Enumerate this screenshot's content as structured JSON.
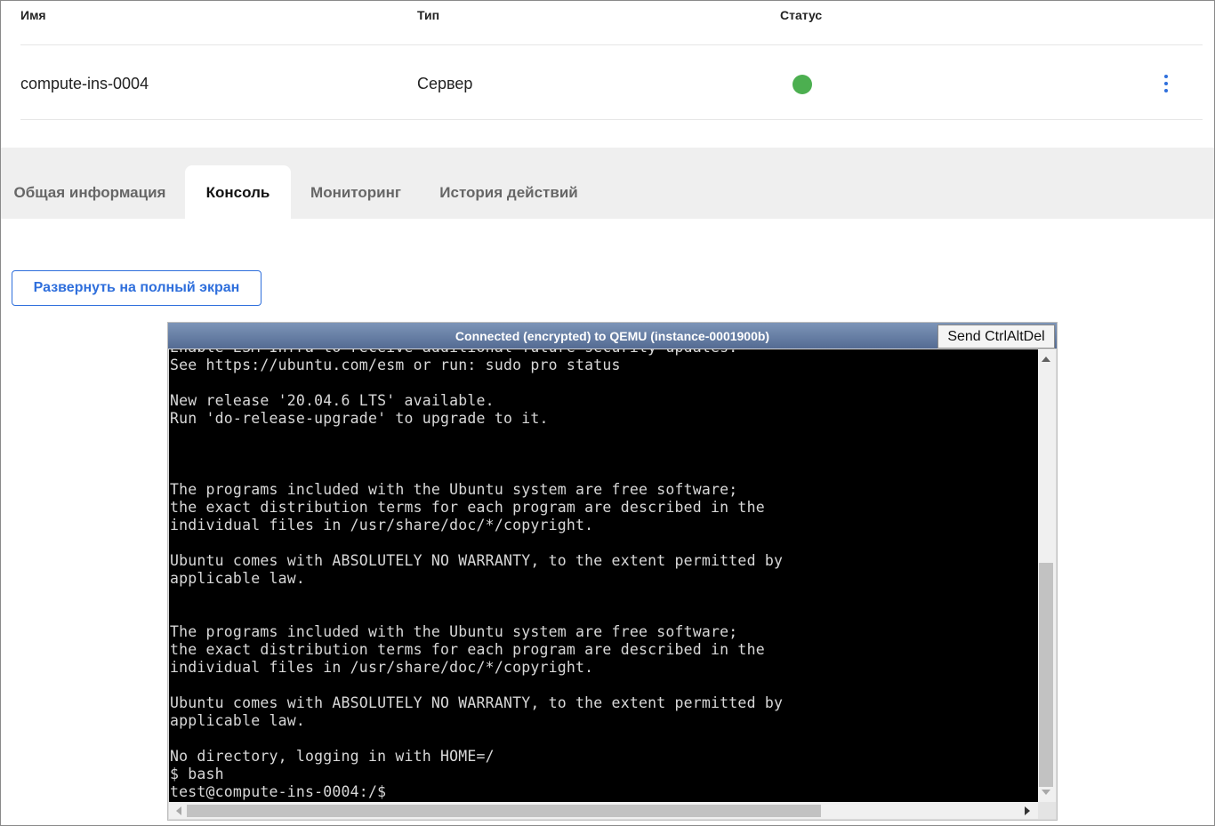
{
  "table": {
    "headers": {
      "name": "Имя",
      "type": "Тип",
      "status": "Статус"
    },
    "row": {
      "name": "compute-ins-0004",
      "type": "Сервер",
      "status_color": "#4caf50"
    }
  },
  "tabs": [
    {
      "label": "Общая информация",
      "active": false
    },
    {
      "label": "Консоль",
      "active": true
    },
    {
      "label": "Мониторинг",
      "active": false
    },
    {
      "label": "История действий",
      "active": false
    }
  ],
  "fullscreen_button": "Развернуть на полный экран",
  "console": {
    "title": "Connected (encrypted) to QEMU (instance-0001900b)",
    "ctrl_alt_del": "Send CtrlAltDel",
    "lines": [
      "Enable ESM Infra to receive additional future security updates.",
      "See https://ubuntu.com/esm or run: sudo pro status",
      "",
      "New release '20.04.6 LTS' available.",
      "Run 'do-release-upgrade' to upgrade to it.",
      "",
      "",
      "",
      "The programs included with the Ubuntu system are free software;",
      "the exact distribution terms for each program are described in the",
      "individual files in /usr/share/doc/*/copyright.",
      "",
      "Ubuntu comes with ABSOLUTELY NO WARRANTY, to the extent permitted by",
      "applicable law.",
      "",
      "",
      "The programs included with the Ubuntu system are free software;",
      "the exact distribution terms for each program are described in the",
      "individual files in /usr/share/doc/*/copyright.",
      "",
      "Ubuntu comes with ABSOLUTELY NO WARRANTY, to the extent permitted by",
      "applicable law.",
      "",
      "No directory, logging in with HOME=/",
      "$ bash",
      "test@compute-ins-0004:/$"
    ]
  },
  "colors": {
    "accent": "#2f6fdc",
    "status_ok": "#4caf50",
    "terminal_bg": "#000000"
  },
  "icons": {
    "row_menu": "kebab-vertical-icon"
  }
}
